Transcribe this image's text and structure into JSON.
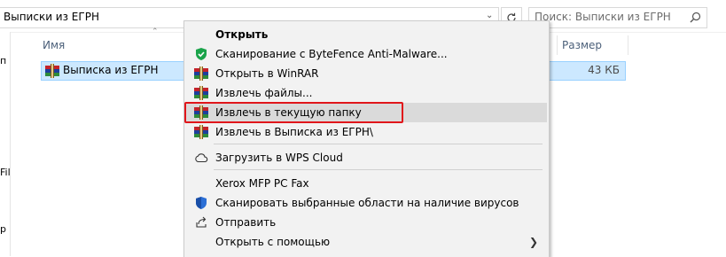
{
  "address_bar": {
    "path": "Выписки из ЕГРН"
  },
  "search": {
    "placeholder": "Поиск: Выписки из ЕГРН"
  },
  "left_pane": {
    "fragments": [
      "п",
      "Fil",
      "р"
    ]
  },
  "columns": {
    "name": "Имя",
    "size": "Размер"
  },
  "file": {
    "name": "Выписка из ЕГРН",
    "size": "43 КБ"
  },
  "context_menu": {
    "items": [
      {
        "label": "Открыть",
        "icon": "none",
        "bold": true
      },
      {
        "label": "Сканирование с ByteFence Anti-Malware...",
        "icon": "bytefence-shield-icon"
      },
      {
        "label": "Открыть в WinRAR",
        "icon": "winrar-icon"
      },
      {
        "label": "Извлечь файлы...",
        "icon": "winrar-icon"
      },
      {
        "label": "Извлечь в текущую папку",
        "icon": "winrar-icon",
        "highlighted": true
      },
      {
        "label": "Извлечь в Выписка из ЕГРН\\",
        "icon": "winrar-icon"
      },
      {
        "label": "Загрузить в WPS Cloud",
        "icon": "cloud-icon"
      },
      {
        "label": "Xerox MFP PC Fax",
        "icon": "none"
      },
      {
        "label": "Сканировать выбранные области на наличие вирусов",
        "icon": "defender-shield-icon"
      },
      {
        "label": "Отправить",
        "icon": "share-icon"
      },
      {
        "label": "Открыть с помощью",
        "icon": "none",
        "submenu": true
      }
    ],
    "highlight_color": "#e0161b"
  },
  "colors": {
    "selection_bg": "#cce8ff",
    "selection_border": "#99d1ff",
    "menu_bg": "#f2f2f2"
  }
}
